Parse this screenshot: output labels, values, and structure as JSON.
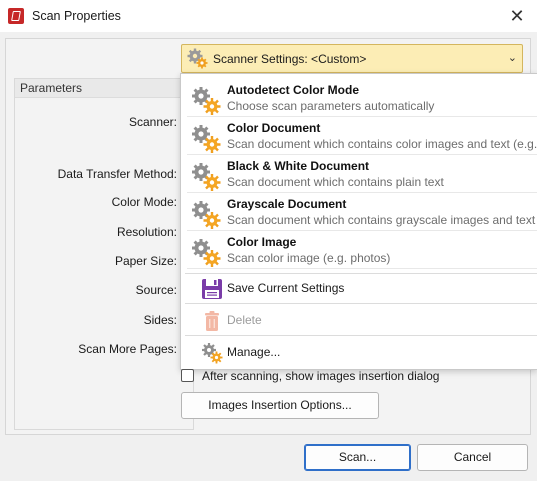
{
  "window": {
    "title": "Scan Properties"
  },
  "parameters": {
    "group_title": "Parameters",
    "labels": {
      "scanner": "Scanner:",
      "data_transfer": "Data Transfer Method:",
      "color_mode": "Color Mode:",
      "resolution": "Resolution:",
      "paper_size": "Paper Size:",
      "source": "Source:",
      "sides": "Sides:",
      "scan_more": "Scan More Pages:"
    }
  },
  "settings": {
    "label": "Scanner Settings:  <Custom>"
  },
  "menu": {
    "presets": [
      {
        "title": "Autodetect Color Mode",
        "desc": "Choose scan parameters automatically"
      },
      {
        "title": "Color Document",
        "desc": "Scan document which contains color images and text (e.g."
      },
      {
        "title": "Black & White Document",
        "desc": "Scan document which contains plain text"
      },
      {
        "title": "Grayscale Document",
        "desc": "Scan document which contains grayscale images and text ("
      },
      {
        "title": "Color Image",
        "desc": "Scan color image (e.g. photos)"
      }
    ],
    "actions": {
      "save": "Save Current Settings",
      "delete": "Delete",
      "manage": "Manage..."
    }
  },
  "after_scan_checkbox": {
    "label": "After scanning, show images insertion dialog"
  },
  "buttons": {
    "images_insertion": "Images Insertion Options...",
    "scan": "Scan...",
    "cancel": "Cancel"
  }
}
